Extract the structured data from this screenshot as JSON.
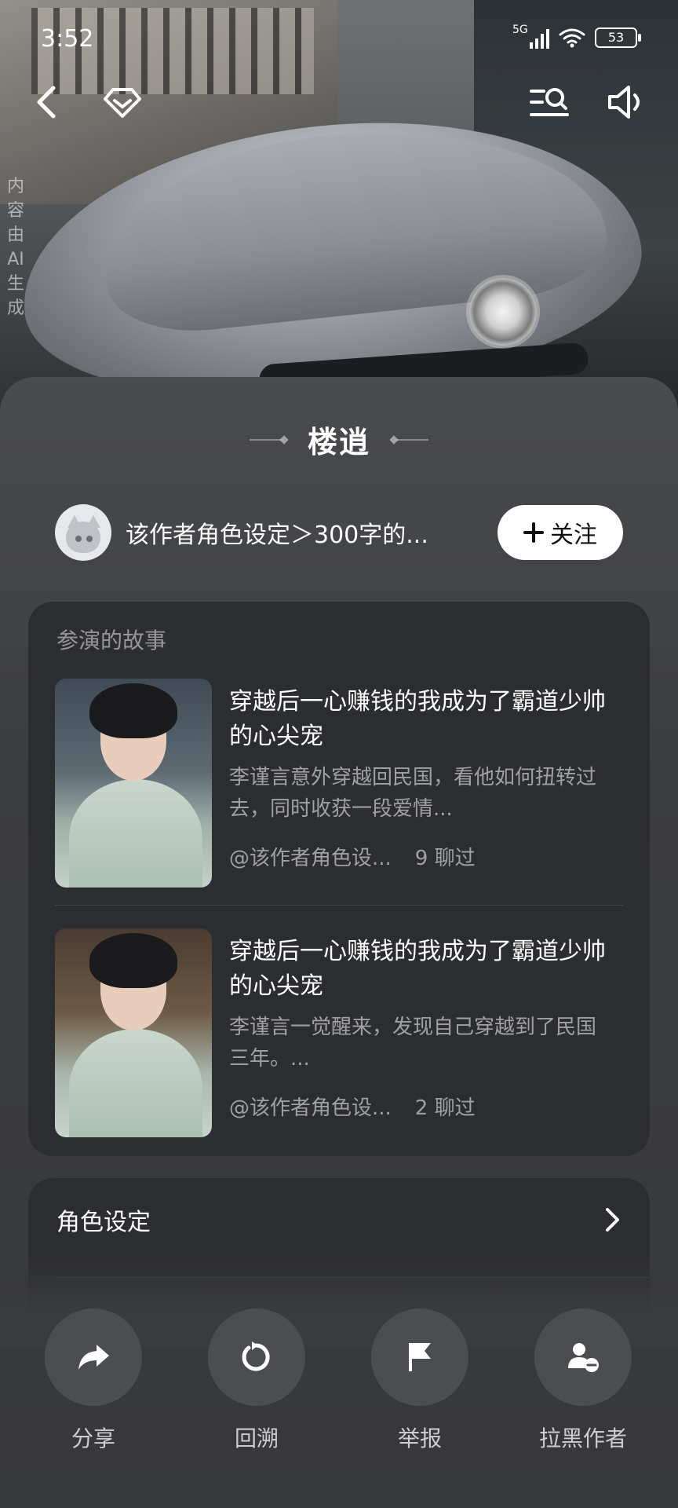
{
  "status_bar": {
    "time": "3:52",
    "network": "5G",
    "battery": "53"
  },
  "hero": {
    "ai_watermark": "内容由AI生成"
  },
  "character": {
    "name": "楼逍"
  },
  "author": {
    "name": "该作者角色设定＞300字的...",
    "follow_label": "关注"
  },
  "stories": {
    "section_title": "参演的故事",
    "items": [
      {
        "title": "穿越后一心赚钱的我成为了霸道少帅的心尖宠",
        "description": "李谨言意外穿越回民国，看他如何扭转过去，同时收获一段爱情...",
        "author": "@该作者角色设...",
        "chats": "9 聊过"
      },
      {
        "title": "穿越后一心赚钱的我成为了霸道少帅的心尖宠",
        "description": "李谨言一觉醒来，发现自己穿越到了民国三年。...",
        "author": "@该作者角色设...",
        "chats": "2 聊过"
      }
    ]
  },
  "settings": {
    "label": "角色设定"
  },
  "actions": [
    {
      "label": "分享",
      "icon": "share-icon"
    },
    {
      "label": "回溯",
      "icon": "rewind-icon"
    },
    {
      "label": "举报",
      "icon": "flag-icon"
    },
    {
      "label": "拉黑作者",
      "icon": "block-user-icon"
    }
  ]
}
